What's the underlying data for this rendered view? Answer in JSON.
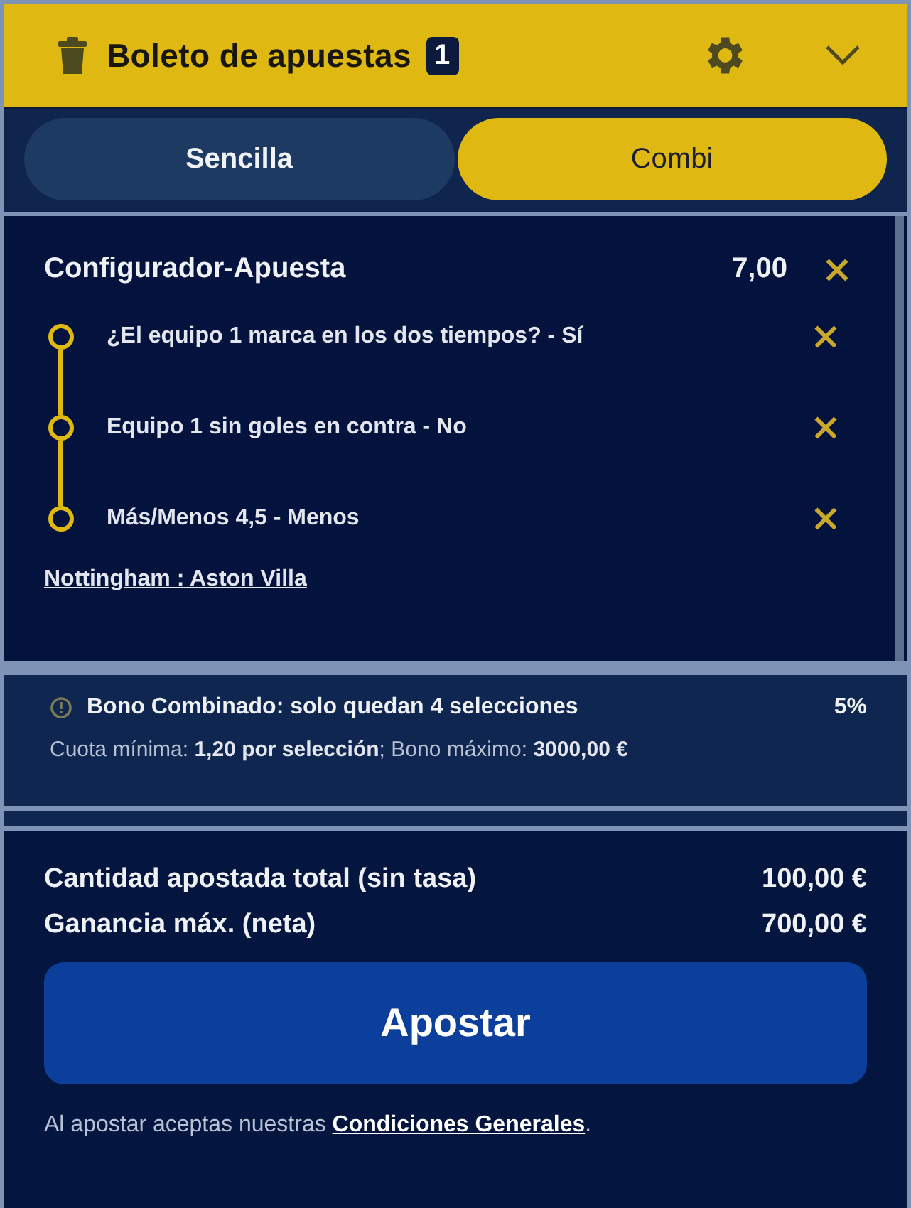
{
  "header": {
    "title": "Boleto de apuestas",
    "count": "1"
  },
  "tabs": [
    {
      "label": "Sencilla",
      "selected": false
    },
    {
      "label": "Combi",
      "selected": true
    }
  ],
  "selection": {
    "title": "Configurador-Apuesta",
    "odds": "7,00",
    "legs": [
      {
        "label": "¿El equipo 1 marca en los dos tiempos? - Sí"
      },
      {
        "label": "Equipo 1 sin goles en contra - No"
      },
      {
        "label": "Más/Menos 4,5 - Menos"
      }
    ],
    "match": "Nottingham : Aston Villa"
  },
  "bonus": {
    "message": "Bono Combinado: solo quedan 4 selecciones",
    "percent": "5%",
    "detail": "Cuota mínima: **1,20 por selección**; Bono máximo: **3000,00 €**"
  },
  "summary": [
    {
      "label": "Cantidad apostada total (sin tasa)",
      "value": "100,00 €"
    },
    {
      "label": "Ganancia máx. (neta)",
      "value": "700,00 €"
    }
  ],
  "bet_button": "Apostar",
  "terms": {
    "text": "Al apostar aceptas nuestras",
    "link": "Condiciones Generales",
    "suffix": "."
  }
}
